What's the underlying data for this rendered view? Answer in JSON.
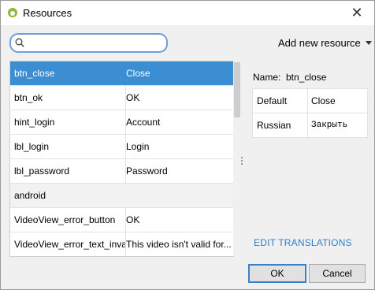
{
  "window": {
    "title": "Resources",
    "close_glyph": "✕",
    "app_icon": "android-studio-icon"
  },
  "toolbar": {
    "search_placeholder": "",
    "search_value": "",
    "add_resource_label": "Add new resource"
  },
  "resources": [
    {
      "key": "btn_close",
      "value": "Close",
      "selected": true
    },
    {
      "key": "btn_ok",
      "value": "OK"
    },
    {
      "key": "hint_login",
      "value": "Account"
    },
    {
      "key": "lbl_login",
      "value": "Login"
    },
    {
      "key": "lbl_password",
      "value": "Password"
    },
    {
      "key": "android",
      "value": "",
      "group": true
    },
    {
      "key": "VideoView_error_button",
      "value": "OK"
    },
    {
      "key": "VideoView_error_text_inva",
      "value": "This video isn't valid for..."
    }
  ],
  "detail": {
    "name_label": "Name:",
    "name_value": "btn_close",
    "translations": [
      {
        "lang": "Default",
        "value": "Close"
      },
      {
        "lang": "Russian",
        "value": "Закрыть"
      }
    ],
    "edit_translations_label": "EDIT TRANSLATIONS"
  },
  "buttons": {
    "ok_label": "OK",
    "cancel_label": "Cancel"
  },
  "colors": {
    "selection": "#3b8ed2",
    "link": "#2f7fcd",
    "focus_border": "#3c7fd0"
  }
}
